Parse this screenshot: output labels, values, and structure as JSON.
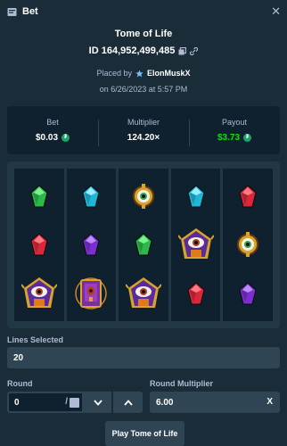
{
  "header": {
    "title": "Bet"
  },
  "bet": {
    "game_name": "Tome of Life",
    "id": "ID 164,952,499,485",
    "placed_by_prefix": "Placed by",
    "user": "ElonMuskX",
    "date": "on 6/26/2023 at 5:57 PM"
  },
  "summary": {
    "bet_label": "Bet",
    "bet_value": "$0.03",
    "multiplier_label": "Multiplier",
    "multiplier_value": "124.20×",
    "payout_label": "Payout",
    "payout_value": "$3.73",
    "payout_color": "#00e701"
  },
  "reels": [
    [
      "green-gem",
      "red-gem",
      "purple-eye-totem"
    ],
    [
      "cyan-gem",
      "purple-gem",
      "tome-book"
    ],
    [
      "gold-eye",
      "green-gem",
      "purple-eye-totem"
    ],
    [
      "cyan-gem",
      "purple-eye-totem",
      "red-gem"
    ],
    [
      "red-gem",
      "gold-eye",
      "purple-gem"
    ]
  ],
  "form": {
    "lines_label": "Lines Selected",
    "lines_value": "20",
    "round_label": "Round",
    "round_value": "0",
    "round_slash": "/",
    "round_multiplier_label": "Round Multiplier",
    "round_multiplier_value": "6.00",
    "round_multiplier_suffix": "X"
  },
  "play_button": "Play Tome of Life"
}
